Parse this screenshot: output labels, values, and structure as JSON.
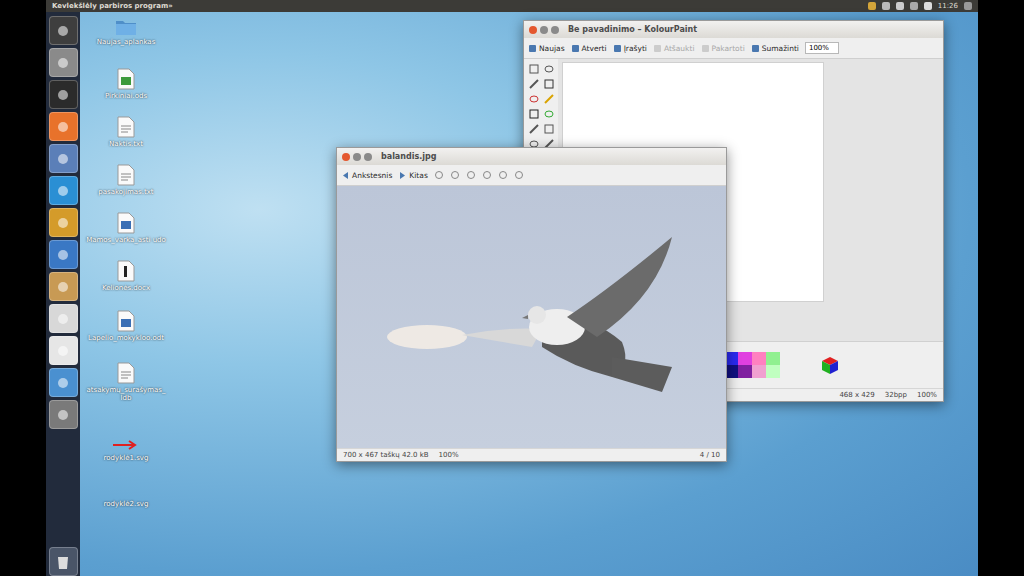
{
  "top_bar": {
    "title": "Kevlekšlėly parbiros program»",
    "time": "11:26"
  },
  "desktop_icons": [
    {
      "label": "Naujas_aplankas",
      "kind": "folder"
    },
    {
      "label": "Pirkiniai.ods",
      "kind": "sheet"
    },
    {
      "label": "Naktis.txt",
      "kind": "text"
    },
    {
      "label": "pasakojimas.txt",
      "kind": "text"
    },
    {
      "label": "Mamos_varka_asti udo",
      "kind": "doc"
    },
    {
      "label": "Kelionės.docx",
      "kind": "textdoc"
    },
    {
      "label": "Lapelio_mokykloo.odt",
      "kind": "doc"
    },
    {
      "label": "atsakymų_surašymas_ldb",
      "kind": "text"
    },
    {
      "label": "rodyklė1.svg",
      "kind": "arrow"
    },
    {
      "label": "rodyklė2.svg",
      "kind": "plain"
    }
  ],
  "paint_window": {
    "title": "Be pavadinimo – KolourPaint",
    "toolbar": [
      {
        "label": "Naujas",
        "disabled": false
      },
      {
        "label": "Atverti",
        "disabled": false
      },
      {
        "label": "Įrašyti",
        "disabled": false
      },
      {
        "label": "Atšaukti",
        "disabled": true
      },
      {
        "label": "Pakartoti",
        "disabled": true
      },
      {
        "label": "Sumažinti",
        "disabled": false
      }
    ],
    "zoom": "100%",
    "palette": [
      {
        "color": "#2a2af0"
      },
      {
        "color": "#e040e0"
      },
      {
        "color": "#ff80c0"
      },
      {
        "color": "#90f090"
      },
      {
        "color": "#101080"
      },
      {
        "color": "#8020a0"
      },
      {
        "color": "#f0a0d0"
      },
      {
        "color": "#c0ffc0"
      }
    ],
    "status": [
      "468 x 429",
      "32bpp",
      "100%"
    ]
  },
  "viewer_window": {
    "title": "balandis.jpg",
    "toolbar": [
      {
        "label": "Ankstesnis"
      },
      {
        "label": "Kitas"
      }
    ],
    "status": {
      "info": "700 x 467 taškų 42.0 kB",
      "zoom": "100%",
      "position": "4 / 10"
    }
  }
}
